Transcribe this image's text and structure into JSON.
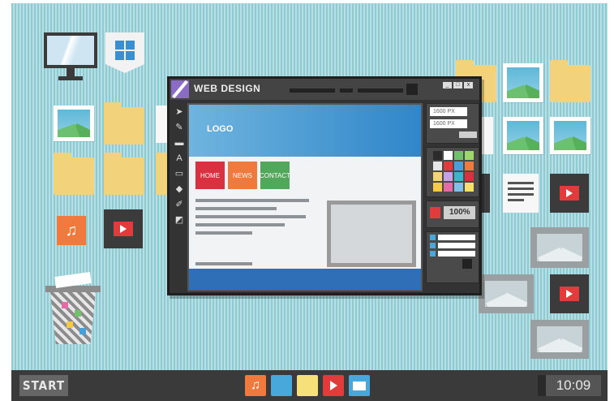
{
  "window": {
    "title": "WEB DESIGN",
    "controls": [
      "_",
      "□",
      "x"
    ]
  },
  "page": {
    "logo": "LOGO",
    "nav": [
      {
        "label": "HOME",
        "color": "#d9313f"
      },
      {
        "label": "NEWS",
        "color": "#f07a3e"
      },
      {
        "label": "CONTACT",
        "color": "#52a85a"
      }
    ]
  },
  "panel": {
    "width_field": "1600 PX",
    "height_field": "1600 PX",
    "zoom": "100%",
    "swatch_colors": [
      "#2b2b2b",
      "#ffffff",
      "#6fc26a",
      "#9cd96a",
      "#e8e8e8",
      "#e23b3b",
      "#4a9fd8",
      "#f07a3e",
      "#f2d27a",
      "#c9a0e6",
      "#3bb6c8",
      "#d9313f",
      "#f6c947",
      "#e66aa6",
      "#7fc0e8",
      "#f5e06a"
    ]
  },
  "taskbar": {
    "start": "START",
    "clock": "10:09"
  },
  "colors": {
    "accent_blue": "#2f86c9",
    "desktop": "#8fcad3",
    "taskbar": "#3a3a3a"
  }
}
